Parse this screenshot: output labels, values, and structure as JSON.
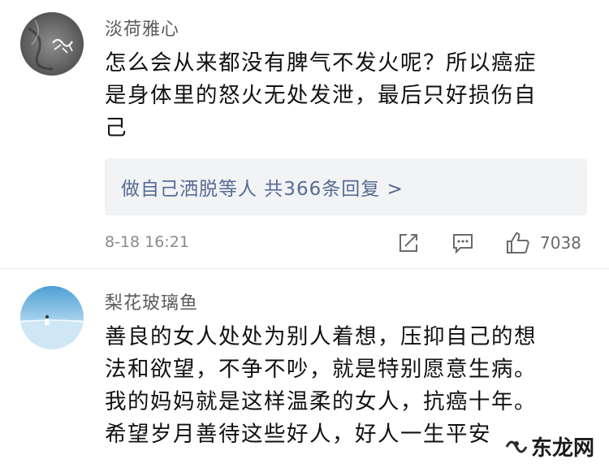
{
  "comments": [
    {
      "avatar_icon": "ink-calligraphy-avatar-icon",
      "username": "淡荷雅心",
      "content_lines": [
        "怎么会从来都没有脾气不发火呢？所以癌症",
        "是身体里的怒火无处发泄，最后只好损伤自",
        "己"
      ],
      "reply_summary": "做自己洒脱等人 共366条回复 >",
      "timestamp": "8-18 16:21",
      "like_count": "7038"
    },
    {
      "avatar_icon": "seaside-person-avatar-icon",
      "username": "梨花玻璃鱼",
      "content_lines": [
        "善良的女人处处为别人着想，压抑自己的想",
        "法和欲望，不争不吵，就是特别愿意生病。",
        "我的妈妈就是这样温柔的女人，抗癌十年。",
        "希望岁月善待这些好人，好人一生平安"
      ]
    }
  ],
  "watermark": {
    "text": "东龙网",
    "icon": "site-logo-icon"
  },
  "colors": {
    "link": "#576b95",
    "reply_bg": "#f2f3f5",
    "meta_gray": "#8a8a8a"
  }
}
